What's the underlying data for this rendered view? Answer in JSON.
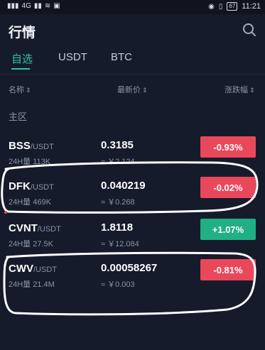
{
  "status_bar": {
    "left": [
      "▮▮▮",
      "4G",
      "▮▮",
      "≋",
      "▣"
    ],
    "battery": "67",
    "time": "11:21"
  },
  "header": {
    "title": "行情",
    "search_icon": "search-icon"
  },
  "tabs": [
    {
      "label": "自选",
      "active": true
    },
    {
      "label": "USDT",
      "active": false
    },
    {
      "label": "BTC",
      "active": false
    }
  ],
  "columns": {
    "name": "名称",
    "price": "最新价",
    "change": "涨跌幅"
  },
  "section_label": "主区",
  "rows": [
    {
      "base": "BSS",
      "quote": "/USDT",
      "volume": "24H量 113K",
      "price": "0.3185",
      "cny": "≈ ￥2.124",
      "change": "-0.93%",
      "direction": "down"
    },
    {
      "base": "DFK",
      "quote": "/USDT",
      "volume": "24H量 469K",
      "price": "0.040219",
      "cny": "≈ ￥0.268",
      "change": "-0.02%",
      "direction": "down"
    },
    {
      "base": "CVNT",
      "quote": "/USDT",
      "volume": "24H量 27.5K",
      "price": "1.8118",
      "cny": "≈ ￥12.084",
      "change": "+1.07%",
      "direction": "up"
    },
    {
      "base": "CWV",
      "quote": "/USDT",
      "volume": "24H量 21.4M",
      "price": "0.00058267",
      "cny": "≈ ￥0.003",
      "change": "-0.81%",
      "direction": "down"
    }
  ],
  "colors": {
    "accent": "#2ec4a5",
    "down": "#e9485b",
    "up": "#20b083",
    "background": "#161b2b",
    "annotation": "#ffffff"
  }
}
